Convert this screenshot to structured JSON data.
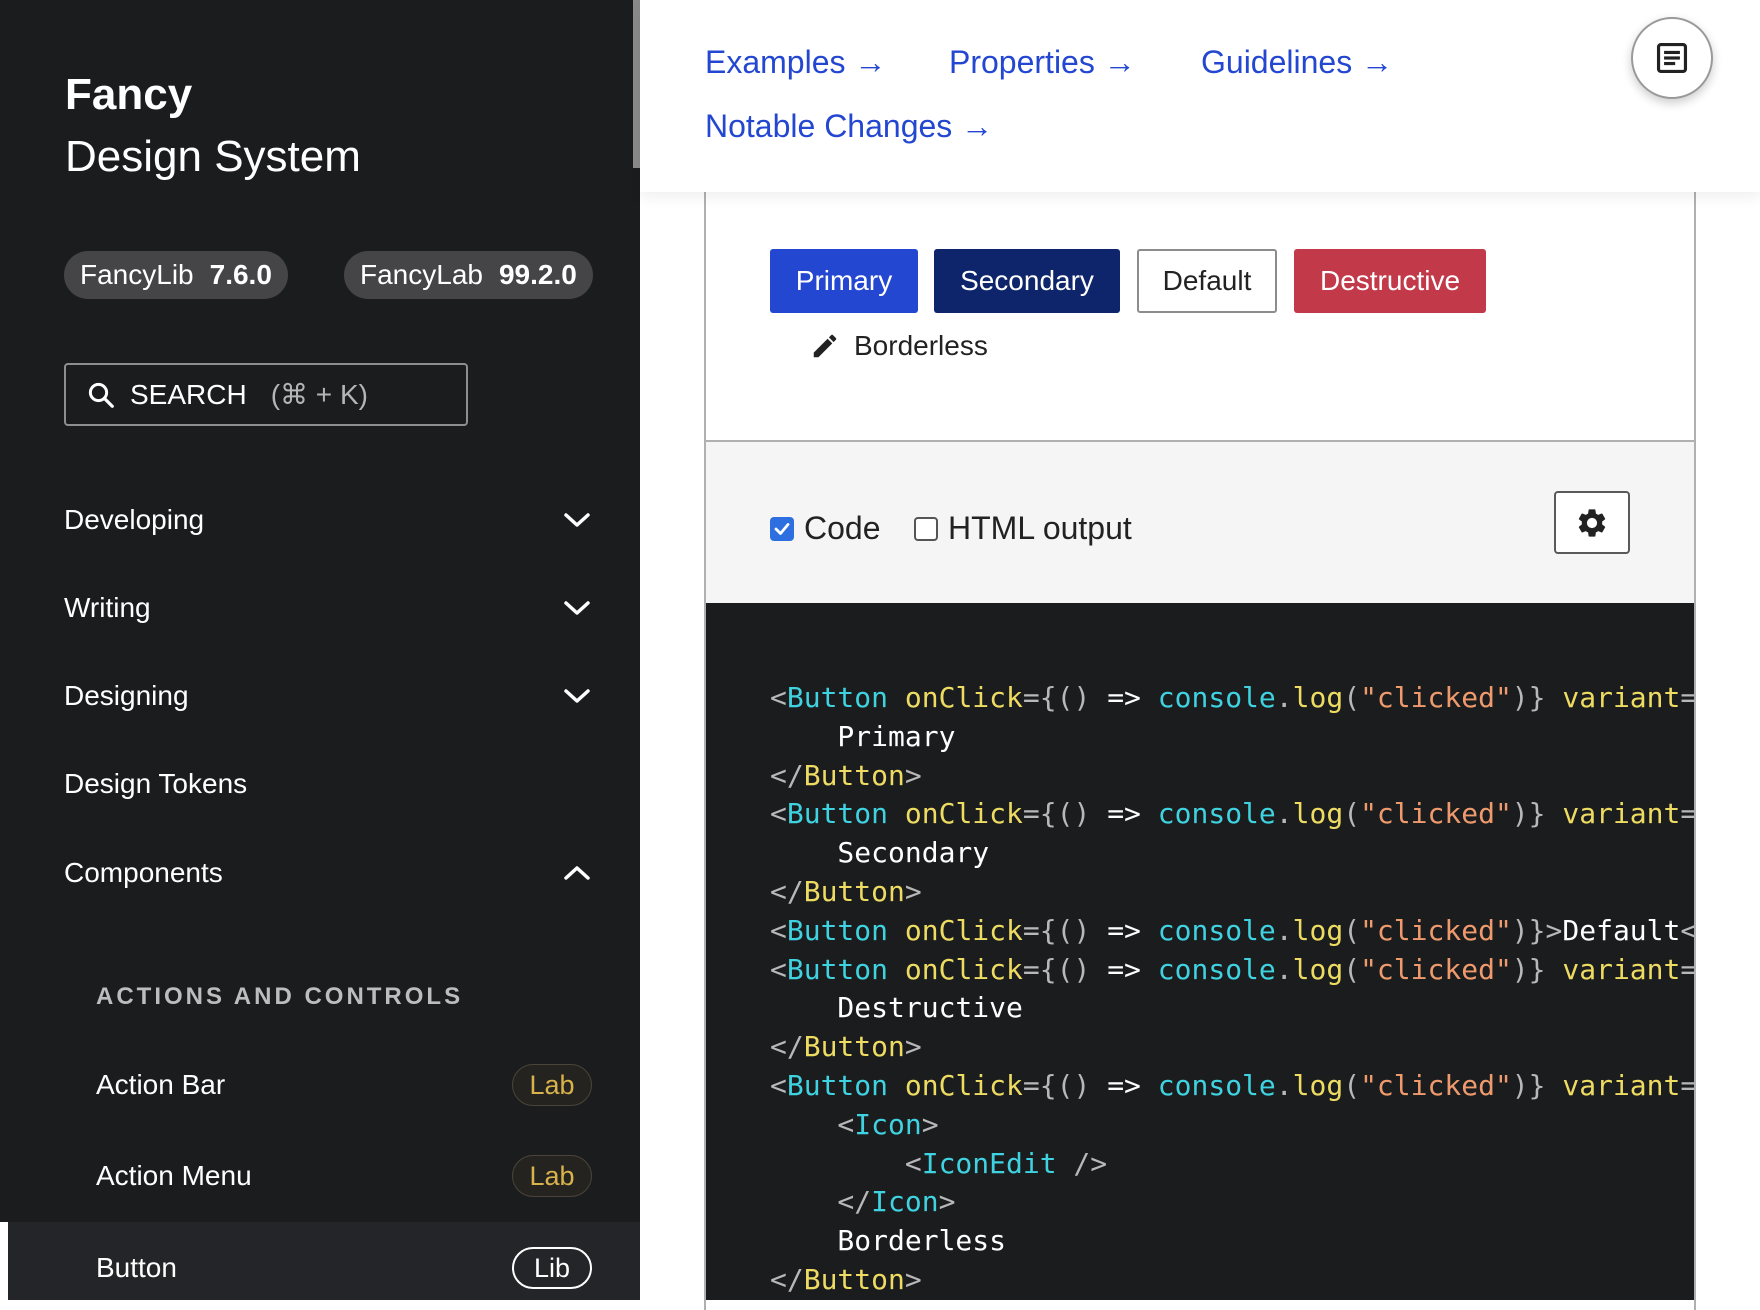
{
  "brand": {
    "title": "Fancy",
    "subtitle": "Design System"
  },
  "versions": [
    {
      "name": "FancyLib",
      "version": "7.6.0"
    },
    {
      "name": "FancyLab",
      "version": "99.2.0"
    }
  ],
  "search": {
    "label": "SEARCH",
    "shortcut": "(⌘ + K)"
  },
  "nav": {
    "items": [
      {
        "label": "Developing",
        "chevron": "chevron-down-icon"
      },
      {
        "label": "Writing",
        "chevron": "chevron-down-icon"
      },
      {
        "label": "Designing",
        "chevron": "chevron-down-icon"
      },
      {
        "label": "Design Tokens"
      },
      {
        "label": "Components",
        "chevron": "chevron-up-icon"
      }
    ],
    "section_label": "ACTIONS AND CONTROLS",
    "sub_items": [
      {
        "label": "Action Bar",
        "badge": "Lab"
      },
      {
        "label": "Action Menu",
        "badge": "Lab"
      },
      {
        "label": "Button",
        "badge": "Lib",
        "active": true
      }
    ]
  },
  "toc": {
    "links": [
      "Examples →",
      "Properties →",
      "Guidelines →",
      "Notable Changes →"
    ],
    "toggle_icon": "document-list-icon"
  },
  "demo": {
    "buttons": {
      "primary": "Primary",
      "secondary": "Secondary",
      "default": "Default",
      "destructive": "Destructive",
      "borderless": "Borderless"
    },
    "borderless_icon": "pencil-icon",
    "colors": {
      "primary": "#2347d1",
      "secondary": "#0f256b",
      "destructive": "#c23a4a"
    }
  },
  "controls": {
    "code_label": "Code",
    "code_checked": true,
    "html_label": "HTML output",
    "html_checked": false,
    "settings_icon": "gear-icon"
  },
  "code": {
    "lines": [
      [
        [
          "c-p",
          "<"
        ],
        [
          "c-t",
          "Button"
        ],
        [
          "c-o",
          " "
        ],
        [
          "c-a",
          "onClick"
        ],
        [
          "c-p",
          "={() "
        ],
        [
          "c-x",
          "=>"
        ],
        [
          "c-o",
          " "
        ],
        [
          "c-t",
          "console"
        ],
        [
          "c-p",
          "."
        ],
        [
          "c-a",
          "log"
        ],
        [
          "c-p",
          "("
        ],
        [
          "c-s",
          "\"clicked\""
        ],
        [
          "c-p",
          ")} "
        ],
        [
          "c-a",
          "variant"
        ],
        [
          "c-p",
          "="
        ]
      ],
      [
        [
          "c-x",
          "    Primary"
        ]
      ],
      [
        [
          "c-p",
          "</"
        ],
        [
          "c-a",
          "Button"
        ],
        [
          "c-p",
          ">"
        ]
      ],
      [
        [
          "c-p",
          "<"
        ],
        [
          "c-t",
          "Button"
        ],
        [
          "c-o",
          " "
        ],
        [
          "c-a",
          "onClick"
        ],
        [
          "c-p",
          "={() "
        ],
        [
          "c-x",
          "=>"
        ],
        [
          "c-o",
          " "
        ],
        [
          "c-t",
          "console"
        ],
        [
          "c-p",
          "."
        ],
        [
          "c-a",
          "log"
        ],
        [
          "c-p",
          "("
        ],
        [
          "c-s",
          "\"clicked\""
        ],
        [
          "c-p",
          ")} "
        ],
        [
          "c-a",
          "variant"
        ],
        [
          "c-p",
          "="
        ]
      ],
      [
        [
          "c-x",
          "    Secondary"
        ]
      ],
      [
        [
          "c-p",
          "</"
        ],
        [
          "c-a",
          "Button"
        ],
        [
          "c-p",
          ">"
        ]
      ],
      [
        [
          "c-p",
          "<"
        ],
        [
          "c-t",
          "Button"
        ],
        [
          "c-o",
          " "
        ],
        [
          "c-a",
          "onClick"
        ],
        [
          "c-p",
          "={() "
        ],
        [
          "c-x",
          "=>"
        ],
        [
          "c-o",
          " "
        ],
        [
          "c-t",
          "console"
        ],
        [
          "c-p",
          "."
        ],
        [
          "c-a",
          "log"
        ],
        [
          "c-p",
          "("
        ],
        [
          "c-s",
          "\"clicked\""
        ],
        [
          "c-p",
          ")}>"
        ],
        [
          "c-x",
          "Default"
        ],
        [
          "c-p",
          "<"
        ]
      ],
      [
        [
          "c-p",
          "<"
        ],
        [
          "c-t",
          "Button"
        ],
        [
          "c-o",
          " "
        ],
        [
          "c-a",
          "onClick"
        ],
        [
          "c-p",
          "={() "
        ],
        [
          "c-x",
          "=>"
        ],
        [
          "c-o",
          " "
        ],
        [
          "c-t",
          "console"
        ],
        [
          "c-p",
          "."
        ],
        [
          "c-a",
          "log"
        ],
        [
          "c-p",
          "("
        ],
        [
          "c-s",
          "\"clicked\""
        ],
        [
          "c-p",
          ")} "
        ],
        [
          "c-a",
          "variant"
        ],
        [
          "c-p",
          "="
        ]
      ],
      [
        [
          "c-x",
          "    Destructive"
        ]
      ],
      [
        [
          "c-p",
          "</"
        ],
        [
          "c-a",
          "Button"
        ],
        [
          "c-p",
          ">"
        ]
      ],
      [
        [
          "c-p",
          "<"
        ],
        [
          "c-t",
          "Button"
        ],
        [
          "c-o",
          " "
        ],
        [
          "c-a",
          "onClick"
        ],
        [
          "c-p",
          "={() "
        ],
        [
          "c-x",
          "=>"
        ],
        [
          "c-o",
          " "
        ],
        [
          "c-t",
          "console"
        ],
        [
          "c-p",
          "."
        ],
        [
          "c-a",
          "log"
        ],
        [
          "c-p",
          "("
        ],
        [
          "c-s",
          "\"clicked\""
        ],
        [
          "c-p",
          ")} "
        ],
        [
          "c-a",
          "variant"
        ],
        [
          "c-p",
          "="
        ]
      ],
      [
        [
          "c-p",
          "    <"
        ],
        [
          "c-t",
          "Icon"
        ],
        [
          "c-p",
          ">"
        ]
      ],
      [
        [
          "c-p",
          "        <"
        ],
        [
          "c-t",
          "IconEdit"
        ],
        [
          "c-p",
          " />"
        ]
      ],
      [
        [
          "c-p",
          "    </"
        ],
        [
          "c-t",
          "Icon"
        ],
        [
          "c-p",
          ">"
        ]
      ],
      [
        [
          "c-x",
          "    Borderless"
        ]
      ],
      [
        [
          "c-p",
          "</"
        ],
        [
          "c-a",
          "Button"
        ],
        [
          "c-p",
          ">"
        ]
      ]
    ]
  }
}
